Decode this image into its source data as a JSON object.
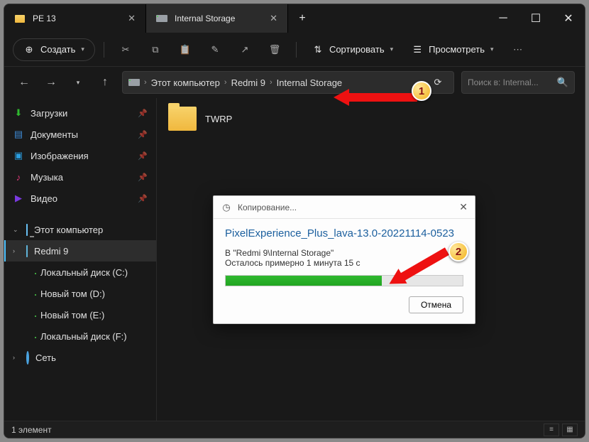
{
  "tabs": [
    {
      "label": "PE 13"
    },
    {
      "label": "Internal Storage"
    }
  ],
  "toolbar": {
    "create_label": "Создать",
    "sort_label": "Сортировать",
    "view_label": "Просмотреть"
  },
  "breadcrumb": {
    "items": [
      "Этот компьютер",
      "Redmi 9",
      "Internal Storage"
    ]
  },
  "search_placeholder": "Поиск в: Internal...",
  "sidebar": {
    "quick": [
      {
        "label": "Загрузки"
      },
      {
        "label": "Документы"
      },
      {
        "label": "Изображения"
      },
      {
        "label": "Музыка"
      },
      {
        "label": "Видео"
      }
    ],
    "this_pc_label": "Этот компьютер",
    "device_label": "Redmi 9",
    "drives": [
      {
        "label": "Локальный диск (C:)"
      },
      {
        "label": "Новый том (D:)"
      },
      {
        "label": "Новый том (E:)"
      },
      {
        "label": "Локальный диск (F:)"
      }
    ],
    "network_label": "Сеть"
  },
  "content": {
    "folder_name": "TWRP"
  },
  "statusbar": {
    "count_label": "1 элемент"
  },
  "dialog": {
    "title": "Копирование...",
    "file": "PixelExperience_Plus_lava-13.0-20221114-0523",
    "dest": "В \"Redmi 9\\Internal Storage\"",
    "eta": "Осталось примерно 1 минута 15 с",
    "progress_percent": 66,
    "cancel_label": "Отмена"
  },
  "annotations": {
    "badge1": "1",
    "badge2": "2"
  }
}
